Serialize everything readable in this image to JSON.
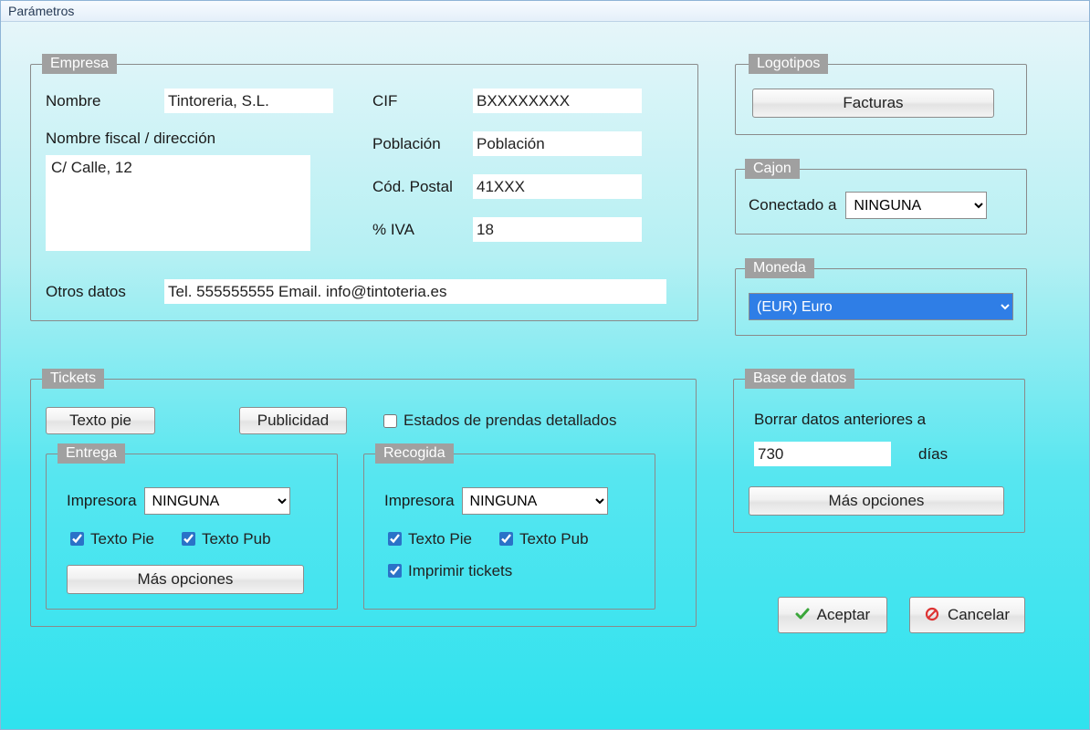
{
  "window": {
    "title": "Parámetros"
  },
  "empresa": {
    "legend": "Empresa",
    "nombre_label": "Nombre",
    "nombre_value": "Tintoreria, S.L.",
    "fiscal_label": "Nombre fiscal / dirección",
    "fiscal_value": "C/ Calle, 12",
    "cif_label": "CIF",
    "cif_value": "BXXXXXXXX",
    "poblacion_label": "Población",
    "poblacion_value": "Población",
    "cp_label": "Cód. Postal",
    "cp_value": "41XXX",
    "iva_label": "% IVA",
    "iva_value": "18",
    "otros_label": "Otros datos",
    "otros_value": "Tel. 555555555 Email. info@tintoteria.es"
  },
  "logotipos": {
    "legend": "Logotipos",
    "facturas_label": "Facturas"
  },
  "cajon": {
    "legend": "Cajon",
    "conectado_label": "Conectado a",
    "option": "NINGUNA"
  },
  "moneda": {
    "legend": "Moneda",
    "option": "(EUR) Euro"
  },
  "tickets": {
    "legend": "Tickets",
    "texto_pie_btn": "Texto pie",
    "publicidad_btn": "Publicidad",
    "estados_label": "Estados de prendas detallados",
    "entrega": {
      "legend": "Entrega",
      "impresora_label": "Impresora",
      "impresora_option": "NINGUNA",
      "texto_pie_label": "Texto Pie",
      "texto_pub_label": "Texto Pub",
      "mas_opciones": "Más opciones"
    },
    "recogida": {
      "legend": "Recogida",
      "impresora_label": "Impresora",
      "impresora_option": "NINGUNA",
      "texto_pie_label": "Texto Pie",
      "texto_pub_label": "Texto Pub",
      "imprimir_label": "Imprimir tickets"
    }
  },
  "basedatos": {
    "legend": "Base de datos",
    "borrar_label": "Borrar datos anteriores a",
    "dias_value": "730",
    "dias_label": "días",
    "mas_opciones": "Más opciones"
  },
  "actions": {
    "aceptar": "Aceptar",
    "cancelar": "Cancelar"
  }
}
